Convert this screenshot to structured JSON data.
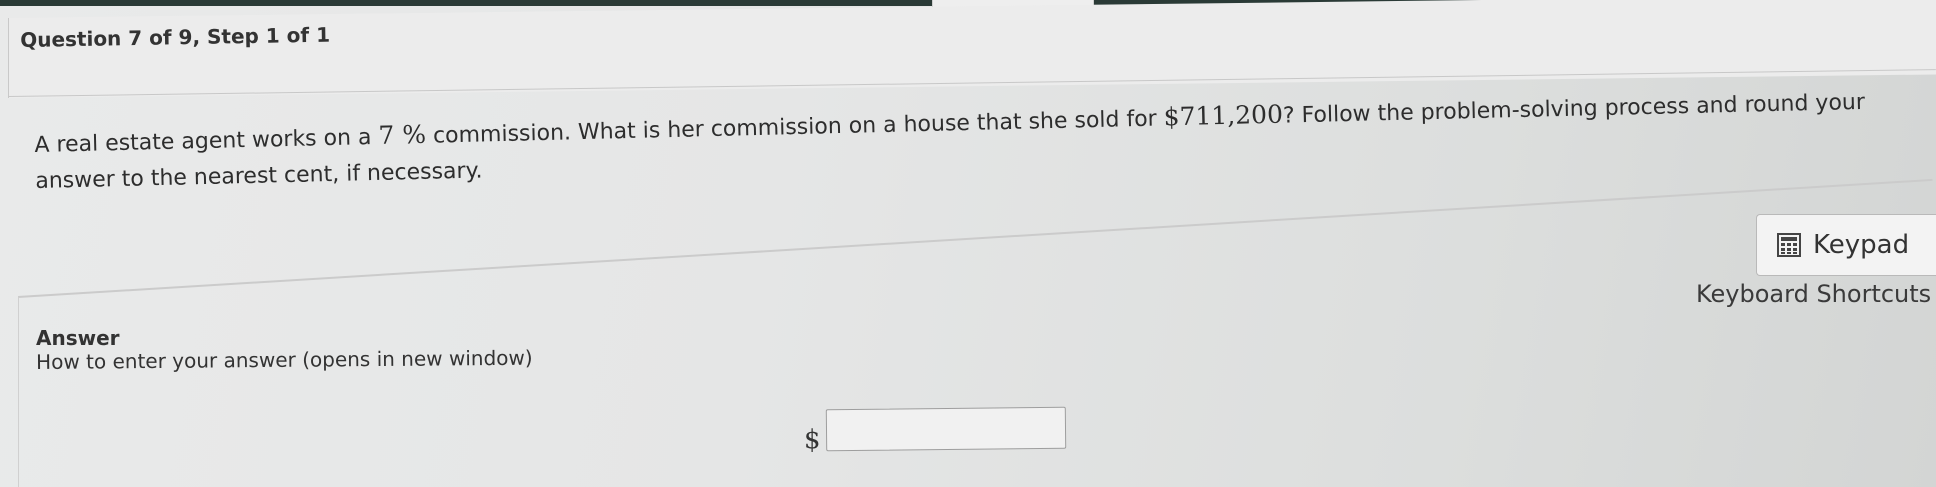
{
  "question": {
    "title": "Question 7 of 9, Step 1 of 1"
  },
  "problem": {
    "text_1": "A real estate agent works on a ",
    "percent": "7 %",
    "text_2": " commission. What is her commission on a house that she sold for ",
    "price": "$711,200",
    "text_3": "? Follow the problem-solving process and round your answer to the nearest cent, if necessary."
  },
  "tools": {
    "keypad_label": "Keypad",
    "keypad_icon": "calculator-icon",
    "shortcuts_label": "Keyboard Shortcuts"
  },
  "answer": {
    "heading": "Answer",
    "help_link": "How to enter your answer (opens in new window)",
    "currency_symbol": "$",
    "value": "",
    "placeholder": ""
  }
}
